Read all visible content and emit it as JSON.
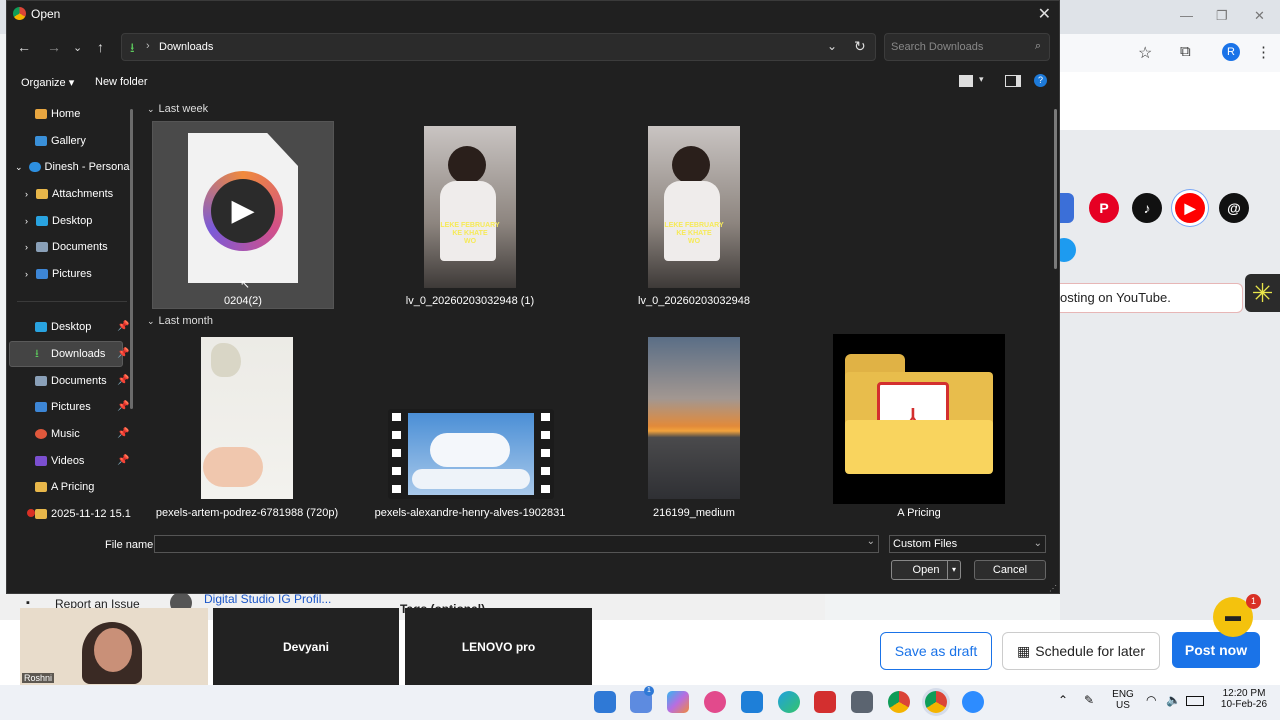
{
  "dialog": {
    "title": "Open",
    "address": "Downloads",
    "search_placeholder": "Search Downloads",
    "toolbar": {
      "organize": "Organize",
      "new_folder": "New folder"
    },
    "sidebar": [
      {
        "label": "Home"
      },
      {
        "label": "Gallery"
      },
      {
        "label": "Dinesh - Persona"
      },
      {
        "label": "Attachments"
      },
      {
        "label": "Desktop"
      },
      {
        "label": "Documents"
      },
      {
        "label": "Pictures"
      },
      {
        "label": "Desktop"
      },
      {
        "label": "Downloads"
      },
      {
        "label": "Documents"
      },
      {
        "label": "Pictures"
      },
      {
        "label": "Music"
      },
      {
        "label": "Videos"
      },
      {
        "label": "A Pricing"
      },
      {
        "label": "2025-11-12 15.1"
      }
    ],
    "groups": [
      {
        "label": "Last week"
      },
      {
        "label": "Last month"
      }
    ],
    "files": [
      {
        "label": "0204(2)"
      },
      {
        "label": "lv_0_20260203032948 (1)"
      },
      {
        "label": "lv_0_20260203032948"
      },
      {
        "label": "pexels-artem-podrez-6781988 (720p)"
      },
      {
        "label": "pexels-alexandre-henry-alves-1902831"
      },
      {
        "label": "216199_medium"
      },
      {
        "label": "A Pricing"
      }
    ],
    "thumb_caption": {
      "line1": "LEKE FEBRUARY",
      "line2": "KE KHATE",
      "line3": "WO"
    },
    "footer": {
      "file_name_label": "File name:",
      "file_name_value": "",
      "filter": "Custom Files",
      "open": "Open",
      "cancel": "Cancel"
    }
  },
  "background": {
    "posting_text": "osting on YouTube.",
    "report": "Report an Issue",
    "profile": "Digital Studio IG Profil...",
    "tags": "Tags (optional)",
    "save_draft": "Save as draft",
    "schedule": "Schedule for later",
    "post_now": "Post now",
    "chat_badge": "1",
    "avatar_letter": "R"
  },
  "meeting": {
    "self_name": "Roshni",
    "participants": [
      "Devyani",
      "LENOVO pro"
    ]
  },
  "taskbar": {
    "lang": "ENG",
    "region": "US",
    "time": "12:20 PM",
    "date": "10-Feb-26",
    "badge": "1"
  },
  "colors": {
    "accent": "#0078d4",
    "post_now": "#1a73e8",
    "dialog_bg": "#202020",
    "selection": "#4a4a4a"
  }
}
